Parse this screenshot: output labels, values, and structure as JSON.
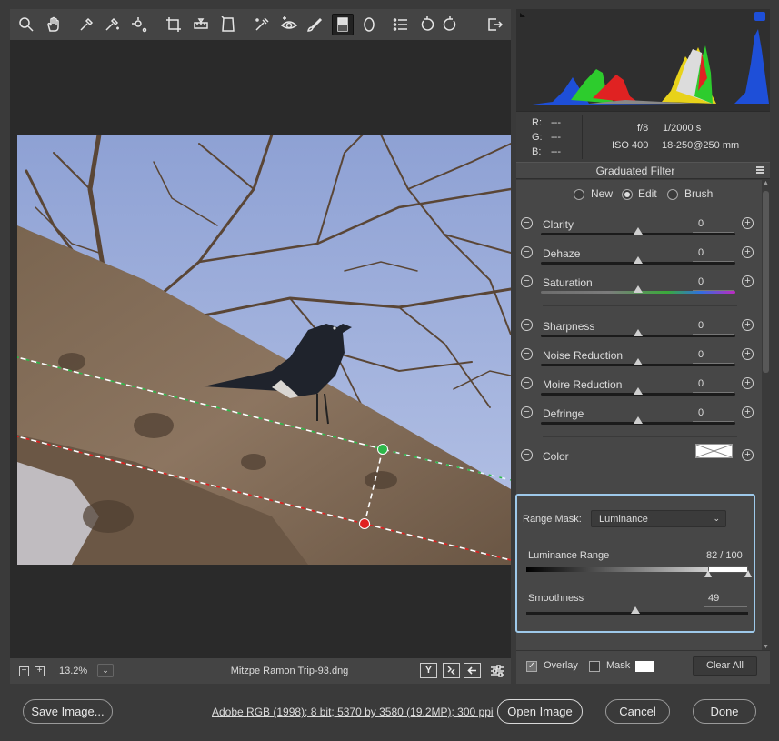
{
  "toolbar": {
    "tools": [
      "zoom-icon",
      "hand-icon",
      "white-balance-icon",
      "color-sampler-icon",
      "targeted-adjustment-icon",
      "crop-icon",
      "straighten-icon",
      "transform-icon",
      "spot-removal-icon",
      "red-eye-icon",
      "adjustment-brush-icon",
      "graduated-filter-icon",
      "radial-filter-icon",
      "presets-list-icon",
      "rotate-left-icon",
      "rotate-right-icon",
      "export-icon"
    ],
    "active_tool": "graduated-filter-icon"
  },
  "status": {
    "zoom_minus": "−",
    "zoom_plus": "+",
    "zoom": "13.2%",
    "zoom_dropdown": "⌄",
    "filename": "Mitzpe Ramon Trip-93.dng",
    "yy_label": "Y"
  },
  "exif": {
    "r_label": "R:",
    "r_value": "---",
    "g_label": "G:",
    "g_value": "---",
    "b_label": "B:",
    "b_value": "---",
    "aperture": "f/8",
    "shutter": "1/2000 s",
    "iso": "ISO 400",
    "lens": "18-250@250 mm"
  },
  "filter": {
    "title": "Graduated Filter",
    "modes": [
      {
        "label": "New",
        "selected": false
      },
      {
        "label": "Edit",
        "selected": true
      },
      {
        "label": "Brush",
        "selected": false
      }
    ],
    "minus": "−",
    "plus": "+",
    "sliders": [
      {
        "label": "Clarity",
        "value": "0",
        "level": 0.5
      },
      {
        "label": "Dehaze",
        "value": "0",
        "level": 0.5
      },
      {
        "label": "Saturation",
        "value": "0",
        "level": 0.5
      },
      {
        "label": "Sharpness",
        "value": "0",
        "level": 0.5
      },
      {
        "label": "Noise Reduction",
        "value": "0",
        "level": 0.5
      },
      {
        "label": "Moire Reduction",
        "value": "0",
        "level": 0.5
      },
      {
        "label": "Defringe",
        "value": "0",
        "level": 0.5
      }
    ],
    "color_label": "Color"
  },
  "range_mask": {
    "label": "Range Mask:",
    "selected": "Luminance",
    "chevron": "⌄",
    "luminance_label": "Luminance Range",
    "luminance_value": "82 / 100",
    "luminance_low": 82,
    "luminance_high": 100,
    "smoothness_label": "Smoothness",
    "smoothness_value": "49"
  },
  "bottom": {
    "overlay_label": "Overlay",
    "overlay_checked": true,
    "check_glyph": "✓",
    "mask_label": "Mask",
    "mask_checked": false,
    "clear_all": "Clear All"
  },
  "footer": {
    "save": "Save Image...",
    "info": "Adobe RGB (1998); 8 bit; 5370 by 3580 (19.2MP); 300 ppi",
    "open": "Open Image",
    "cancel": "Cancel",
    "done": "Done"
  },
  "colors": {
    "accent_focus": "#9ec9ea",
    "pin_green": "#2db84a",
    "pin_red": "#e02020"
  }
}
